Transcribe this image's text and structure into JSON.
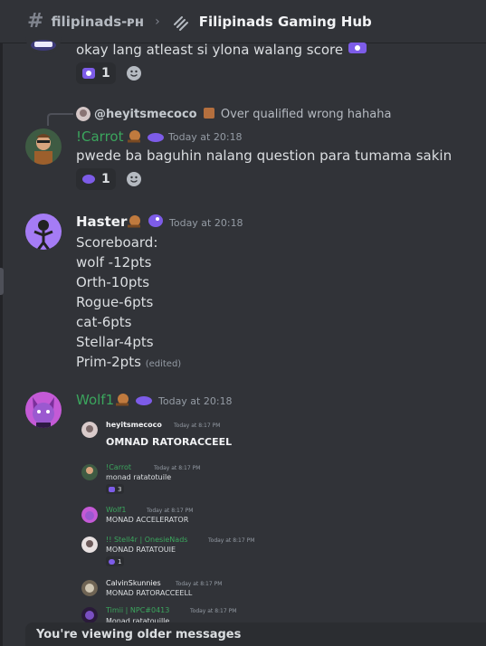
{
  "header": {
    "channel": "filipinads-ᴘʜ",
    "thread_title": "Filipinads Gaming Hub"
  },
  "messages": {
    "prev": {
      "text": "okay lang atleast si ylona walang score",
      "reaction_count": "1"
    },
    "carrot": {
      "reply_author": "@heyitsmecoco",
      "reply_text": "Over qualified wrong hahaha",
      "author": "!Carrot",
      "timestamp": "Today at 20:18",
      "text": "pwede ba baguhin nalang question para tumama sakin",
      "reaction_count": "1"
    },
    "haster": {
      "author": "Haster",
      "timestamp": "Today at 20:18",
      "lines": [
        "Scoreboard:",
        "wolf -12pts",
        "Orth-10pts",
        "Rogue-6pts",
        "cat-6pts",
        "Stellar-4pts",
        "Prim-2pts"
      ],
      "edited": "(edited)"
    },
    "wolf": {
      "author": "Wolf1",
      "timestamp": "Today at 20:18"
    }
  },
  "screenshot": {
    "m1": {
      "author": "heyitsmecoco",
      "ts": "Today at 8:17 PM",
      "text": "OMNAD RATORACCEEL"
    },
    "m2": {
      "author": "!Carrot",
      "ts": "Today at 8:17 PM",
      "text": "monad ratatotuile",
      "reaction": "3"
    },
    "m3": {
      "author": "Wolf1",
      "ts": "Today at 8:17 PM",
      "text": "MONAD ACCELERATOR"
    },
    "m4": {
      "author": "!! Stell4r",
      "tag": "| OnesieNads",
      "ts": "Today at 8:17 PM",
      "text": "MONAD RATATOUIE",
      "reaction": "1"
    },
    "m5": {
      "author": "CalvinSkunnies",
      "ts": "Today at 8:17 PM",
      "text": "MONAD RATORACCEELL"
    },
    "m6": {
      "author": "Timii",
      "tag": "| NPC#0413",
      "ts": "Today at 8:17 PM",
      "text": "Monad ratatouille"
    }
  },
  "older_messages_text": "You're viewing older messages",
  "colors": {
    "carrot": "#3ba55d",
    "haster": "#f2f3f5",
    "wolf": "#3ba55d",
    "bg": "#313338"
  }
}
